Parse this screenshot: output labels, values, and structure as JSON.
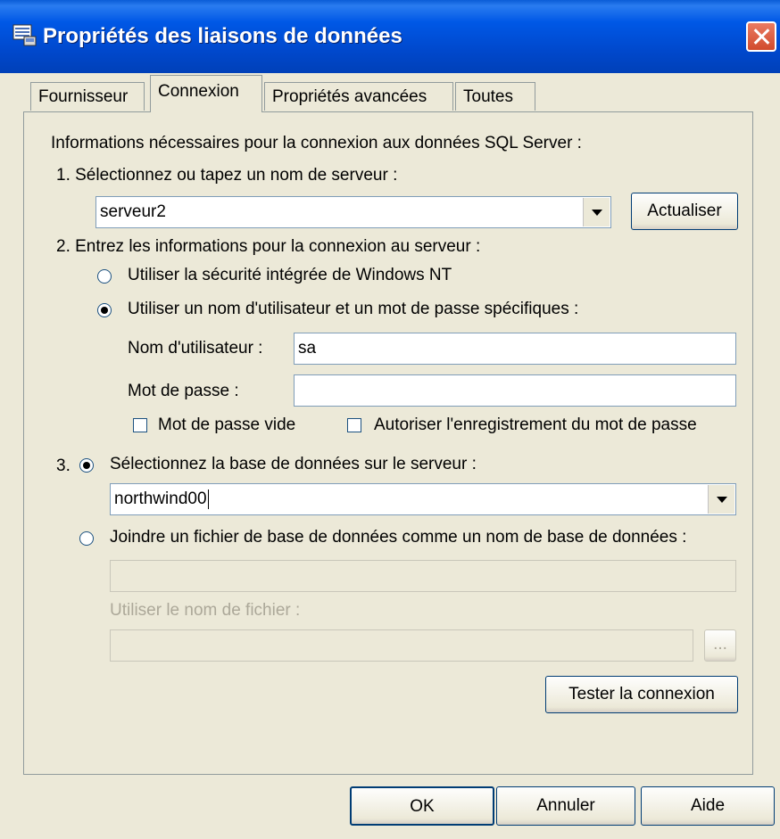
{
  "window": {
    "title": "Propriétés des liaisons de données",
    "icon": "data-link-icon"
  },
  "tabs": [
    {
      "label": "Fournisseur",
      "active": false
    },
    {
      "label": "Connexion",
      "active": true
    },
    {
      "label": "Propriétés avancées",
      "active": false
    },
    {
      "label": "Toutes",
      "active": false
    }
  ],
  "connection": {
    "intro": "Informations nécessaires pour la connexion aux données SQL Server :",
    "step1_label": "1. Sélectionnez ou tapez un nom de serveur :",
    "server_value": "serveur2",
    "refresh_label": "Actualiser",
    "step2_label": "2. Entrez les informations pour la connexion au serveur :",
    "radio_integrated": "Utiliser la sécurité intégrée de Windows NT",
    "radio_specific": "Utiliser un nom d'utilisateur et un mot de passe spécifiques :",
    "username_label": "Nom d'utilisateur :",
    "username_value": "sa",
    "password_label": "Mot de passe :",
    "password_value": "",
    "blank_password": "Mot de passe vide",
    "save_password": "Autoriser l'enregistrement du mot de passe",
    "step3_number": "3.",
    "radio_select_db": "Sélectionnez la base de données sur le serveur :",
    "database_value": "northwind00",
    "radio_attach": "Joindre un fichier de base de données comme un nom de base de données :",
    "attach_value": "",
    "filename_label": "Utiliser le nom de fichier :",
    "filename_value": "",
    "browse_label": "...",
    "test_label": "Tester la connexion"
  },
  "footer": {
    "ok": "OK",
    "cancel": "Annuler",
    "help": "Aide"
  }
}
